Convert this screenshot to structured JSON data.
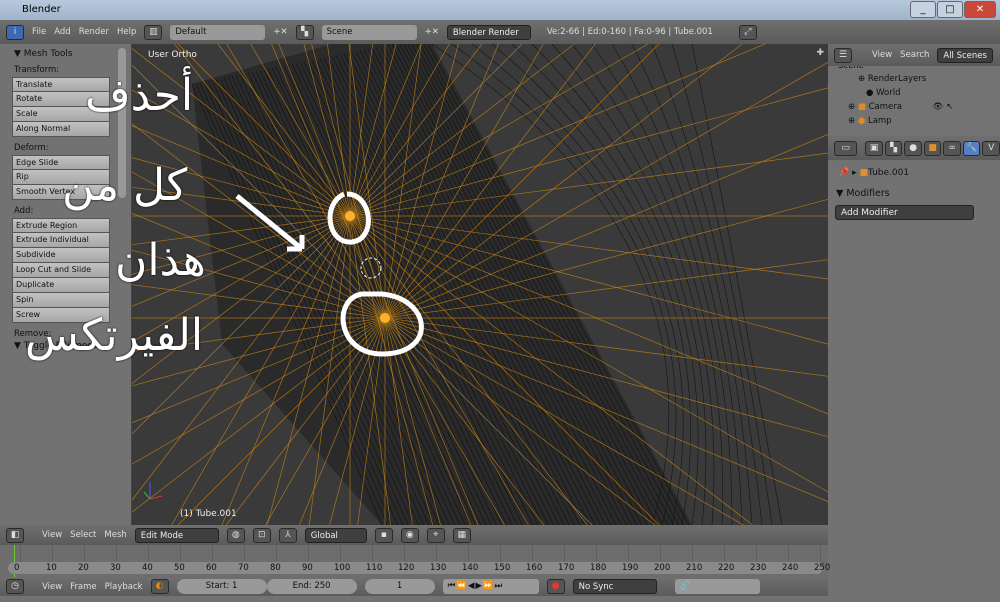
{
  "window": {
    "title": "Blender"
  },
  "header": {
    "menus": [
      "File",
      "Add",
      "Render",
      "Help"
    ],
    "layout": "Default",
    "scene": "Scene",
    "engine": "Blender Render",
    "stats": "Ve:2-66 | Ed:0-160 | Fa:0-96 | Tube.001"
  },
  "tools": {
    "title": "Mesh Tools",
    "sections": [
      {
        "label": "Transform:",
        "buttons": [
          "Translate",
          "Rotate",
          "Scale",
          "Along Normal"
        ]
      },
      {
        "label": "Deform:",
        "buttons": [
          "Edge Slide",
          "Rip",
          "Smooth Vertex"
        ]
      },
      {
        "label": "Add:",
        "buttons": [
          "Extrude Region",
          "Extrude Individual",
          "Subdivide",
          "Loop Cut and Slide",
          "Duplicate",
          "Spin",
          "Screw"
        ]
      }
    ],
    "remove_label": "Remove:",
    "toggle_panel": "Toggle Editmode"
  },
  "viewport": {
    "view_label": "User Ortho",
    "object_label": "(1) Tube.001",
    "annotation": [
      "أحذف",
      "كل من",
      "هذان",
      "الفيرتكس"
    ]
  },
  "outliner": {
    "menus": [
      "View",
      "Search"
    ],
    "filter": "All Scenes",
    "items": [
      "Scene",
      "RenderLayers",
      "World",
      "Camera",
      "Lamp"
    ]
  },
  "properties": {
    "object": "Tube.001",
    "panel": "Modifiers",
    "add_modifier": "Add Modifier"
  },
  "view3d_header": {
    "menus": [
      "View",
      "Select",
      "Mesh"
    ],
    "mode": "Edit Mode",
    "orientation": "Global"
  },
  "timeline": {
    "ticks": [
      0,
      10,
      20,
      30,
      40,
      50,
      60,
      70,
      80,
      90,
      100,
      110,
      120,
      130,
      140,
      150,
      160,
      170,
      180,
      190,
      200,
      210,
      220,
      230,
      240,
      250
    ],
    "menus": [
      "View",
      "Frame",
      "Playback"
    ],
    "start": "Start: 1",
    "end": "End: 250",
    "current": "1",
    "sync": "No Sync"
  }
}
